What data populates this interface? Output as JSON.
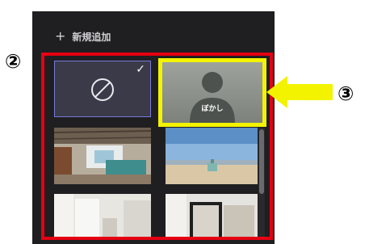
{
  "panel": {
    "add_label": "新規追加",
    "add_icon": "plus-icon"
  },
  "backgrounds": [
    {
      "type": "none",
      "icon": "no-entry-icon",
      "selected": true,
      "selected_icon": "checkmark-icon"
    },
    {
      "type": "blur",
      "label": "ぼかし",
      "icon": "person-silhouette-icon"
    },
    {
      "type": "image",
      "description": "office-interior"
    },
    {
      "type": "image",
      "description": "beach"
    },
    {
      "type": "image",
      "description": "white-room"
    },
    {
      "type": "image",
      "description": "room-with-doorway"
    }
  ],
  "annotations": {
    "marker_2": "②",
    "marker_3": "③",
    "highlight_color": "#e50012",
    "callout_color": "#f3f300"
  }
}
